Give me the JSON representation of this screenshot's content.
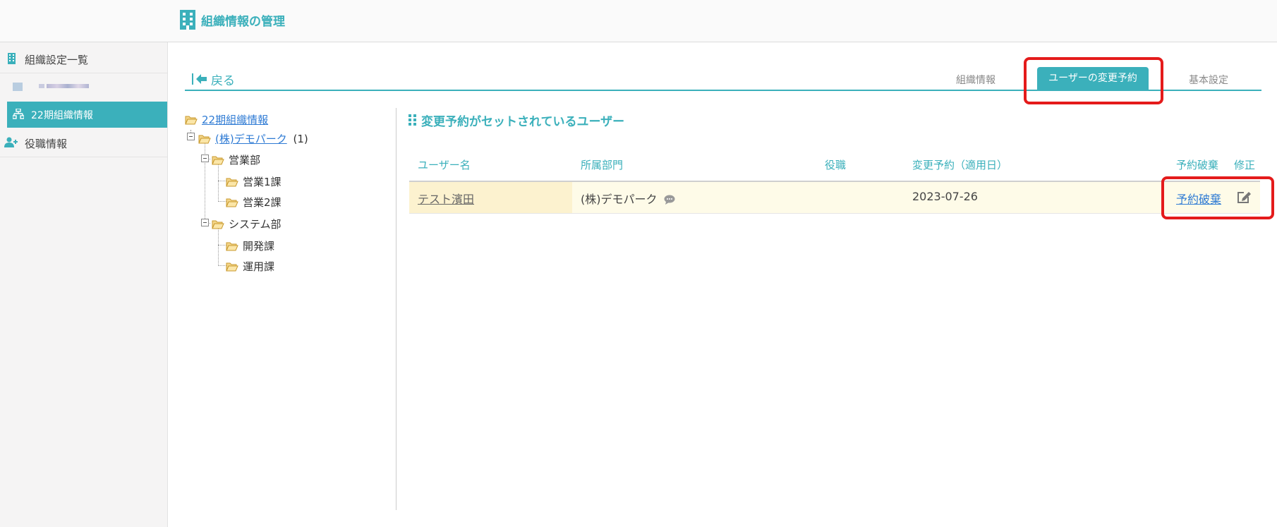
{
  "header": {
    "title": "組織情報の管理",
    "icon": "building-icon"
  },
  "sidebar": {
    "items": [
      {
        "label": "組織設定一覧",
        "icon": "building-icon"
      },
      {
        "label": "",
        "icon": "org-blurred"
      },
      {
        "label": "22期組織情報",
        "icon": "org-chart-icon",
        "active": true
      },
      {
        "label": "役職情報",
        "icon": "user-plus-icon"
      }
    ]
  },
  "nav": {
    "back_label": "戻る",
    "tabs": [
      {
        "label": "組織情報",
        "active": false
      },
      {
        "label": "ユーザーの変更予約",
        "active": true
      },
      {
        "label": "基本設定",
        "active": false
      }
    ]
  },
  "tree": {
    "root": "22期組織情報",
    "company": "(株)デモパーク",
    "company_count": "(1)",
    "nodes": [
      {
        "label": "営業部"
      },
      {
        "label": "営業1課"
      },
      {
        "label": "営業2課"
      },
      {
        "label": "システム部"
      },
      {
        "label": "開発課"
      },
      {
        "label": "運用課"
      }
    ]
  },
  "main": {
    "section_title": "変更予約がセットされているユーザー",
    "columns": [
      "ユーザー名",
      "所属部門",
      "役職",
      "変更予約（適用日）",
      "予約破棄",
      "修正"
    ],
    "rows": [
      {
        "user": "テスト濱田",
        "department": "(株)デモパーク",
        "position": "",
        "apply_date": "2023-07-26",
        "cancel": "予約破棄"
      }
    ]
  },
  "colors": {
    "accent": "#3bb0bb",
    "highlight": "#e41b1b",
    "link": "#2f7bd4"
  }
}
